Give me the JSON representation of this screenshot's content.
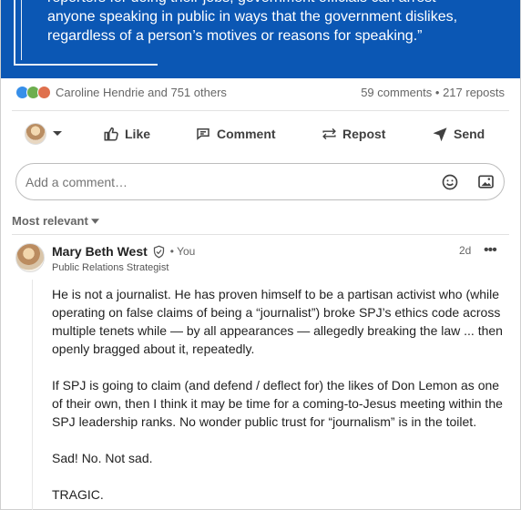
{
  "post": {
    "quote_lines": [
      "reporters for doing their jobs, government officials can arrest",
      "anyone speaking in public in ways that the government dislikes,",
      "regardless of a person’s motives or reasons for speaking.”"
    ],
    "reactions": {
      "names": "Caroline Hendrie and 751 others",
      "comments": "59 comments",
      "separator": "•",
      "reposts": "217 reposts"
    }
  },
  "actions": {
    "like": "Like",
    "comment": "Comment",
    "repost": "Repost",
    "send": "Send"
  },
  "comment_input": {
    "placeholder": "Add a comment…"
  },
  "sort": {
    "label": "Most relevant"
  },
  "comment": {
    "author": "Mary Beth West",
    "meta": "• You",
    "title": "Public Relations Strategist",
    "time": "2d",
    "more": "•••",
    "paragraphs": [
      "He is not a journalist. He has proven himself to be a partisan activist who (while operating on false claims of being a “journalist”) broke SPJ’s ethics code across multiple tenets while — by all appearances — allegedly breaking the law ... then openly bragged about it, repeatedly.",
      "If SPJ is going to claim (and defend / deflect for) the likes of Don Lemon as one of their own, then I think it may be time for a coming-to-Jesus meeting within the SPJ leadership ranks. No wonder public trust for “journalism” is in the toilet.",
      "Sad! No. Not sad.",
      "TRAGIC."
    ]
  },
  "colors": {
    "banner": "#0b57b4",
    "link_blue": "#0a66c2"
  }
}
